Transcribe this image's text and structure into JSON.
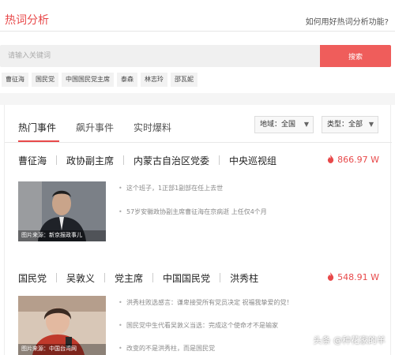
{
  "header": {
    "title": "热词分析",
    "help_link": "如何用好热词分析功能?"
  },
  "search": {
    "placeholder": "请输入关键词",
    "button_label": "搜索"
  },
  "hot_tags": [
    "曹征海",
    "国民党",
    "中国国民党主席",
    "泰森",
    "林志玲",
    "邵瓦妮"
  ],
  "tabs": [
    "热门事件",
    "飙升事件",
    "实时爆料"
  ],
  "filters": {
    "region": "地域：全国",
    "type": "类型：全部"
  },
  "events": [
    {
      "keywords": [
        "曹征海",
        "政协副主席",
        "内蒙古自治区党委",
        "中央巡视组"
      ],
      "heat": "866.97 W",
      "image_caption": "图片来源：新京报政事儿",
      "news": [
        "这个班子，1正部1副部在任上去世",
        "57岁安徽政协副主席曹征海在京病逝 上任仅4个月"
      ]
    },
    {
      "keywords": [
        "国民党",
        "吴敦义",
        "党主席",
        "中国国民党",
        "洪秀柱"
      ],
      "heat": "548.91 W",
      "image_caption": "图片来源：中国台湾网",
      "news": [
        "洪秀柱败选感言：谦卑接受所有党员决定 祝福我挚爱的党！",
        "国民党中生代看吴敦义当选：完成这个使命才不是输家",
        "改变的不是洪秀柱，而是国民党"
      ]
    }
  ],
  "watermark": "头条 @种花家的羊",
  "colors": {
    "accent": "#e8494a",
    "search_button": "#ef5d5b",
    "tag_bg": "#f2f2f2"
  }
}
